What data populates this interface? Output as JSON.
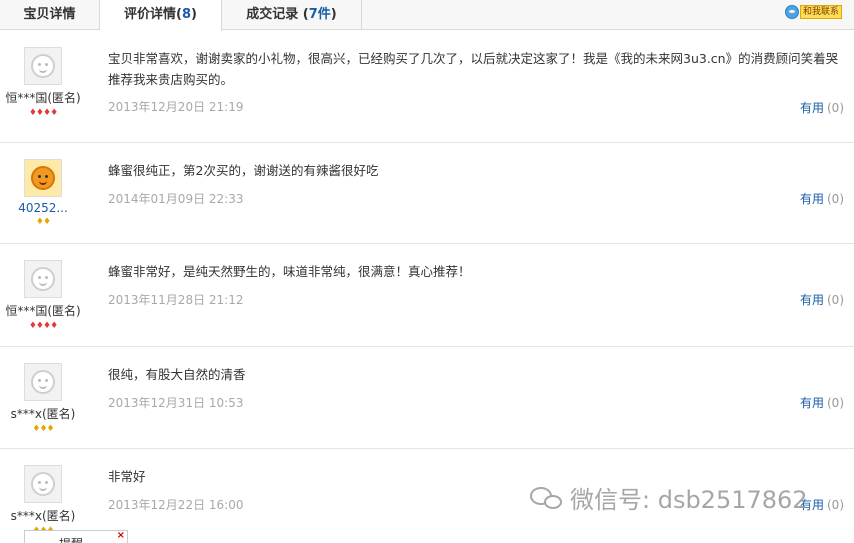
{
  "tabs": [
    {
      "label": "宝贝详情",
      "count": ""
    },
    {
      "label": "评价详情(",
      "count": "8",
      "suffix": ")"
    },
    {
      "label": "成交记录 (",
      "count": "7件",
      "suffix": ")"
    }
  ],
  "contact": {
    "label": "和我联系"
  },
  "reviews": [
    {
      "user": "恒***国(匿名)",
      "badge": "♦♦♦♦",
      "badge_color": "red",
      "text": "宝贝非常喜欢，谢谢卖家的小礼物，很高兴，已经购买了几次了，以后就决定这家了！我是《我的未来网3u3.cn》的消费顾问笑着哭推荐我来贵店购买的。",
      "date": "2013年12月20日 21:19",
      "useful_label": "有用",
      "useful_count": "(0)"
    },
    {
      "user": "40252...",
      "badge": "♦♦",
      "badge_color": "gold",
      "text": "蜂蜜很纯正，第2次买的，谢谢送的有辣酱很好吃",
      "date": "2014年01月09日 22:33",
      "useful_label": "有用",
      "useful_count": "(0)"
    },
    {
      "user": "恒***国(匿名)",
      "badge": "♦♦♦♦",
      "badge_color": "red",
      "text": "蜂蜜非常好，是纯天然野生的，味道非常纯，很满意！真心推荐！",
      "date": "2013年11月28日 21:12",
      "useful_label": "有用",
      "useful_count": "(0)"
    },
    {
      "user": "s***x(匿名)",
      "badge": "♦♦♦",
      "badge_color": "gold",
      "text": "很纯，有股大自然的清香",
      "date": "2013年12月31日 10:53",
      "useful_label": "有用",
      "useful_count": "(0)"
    },
    {
      "user": "s***x(匿名)",
      "badge": "♦♦♦",
      "badge_color": "gold",
      "text": "非常好",
      "date": "2013年12月22日 16:00",
      "useful_label": "有用",
      "useful_count": "(0)"
    }
  ],
  "watermark": {
    "text": "微信号: dsb2517862"
  },
  "popup": {
    "text": "提醒",
    "close": "×"
  }
}
